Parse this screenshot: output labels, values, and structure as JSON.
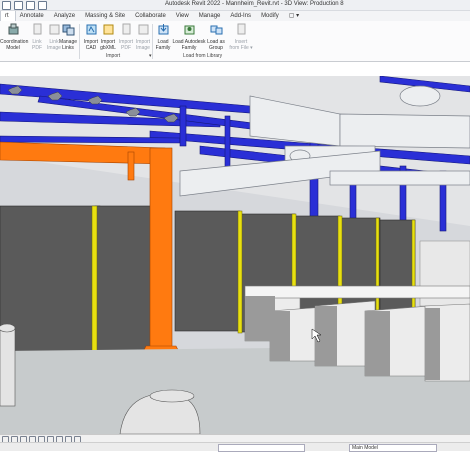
{
  "title": "Autodesk Revit 2022 - Mannheim_Revit.rvt - 3D View: Production 8",
  "tabs": [
    "rt",
    "Annotate",
    "Analyze",
    "Massing & Site",
    "Collaborate",
    "View",
    "Manage",
    "Add-Ins",
    "Modify",
    "▢ ▾"
  ],
  "ribbon": {
    "buttons": [
      {
        "label": "Coordination\nModel",
        "icon": "coordination-model-icon",
        "dim": false
      },
      {
        "label": "Link\nPDF",
        "icon": "link-pdf-icon",
        "dim": true
      },
      {
        "label": "Link\nImage",
        "icon": "link-image-icon",
        "dim": true
      },
      {
        "label": "Manage\nLinks",
        "icon": "manage-links-icon",
        "dim": false
      },
      {
        "label": "Import\nCAD",
        "icon": "import-cad-icon",
        "dim": false
      },
      {
        "label": "Import\ngbXML",
        "icon": "import-gbxml-icon",
        "dim": false
      },
      {
        "label": "Import\nPDF",
        "icon": "import-pdf-icon",
        "dim": true
      },
      {
        "label": "Import\nImage",
        "icon": "import-image-icon",
        "dim": true
      },
      {
        "label": "Load\nFamily",
        "icon": "load-family-icon",
        "dim": false
      },
      {
        "label": "Load Autodesk\nFamily",
        "icon": "load-autodesk-family-icon",
        "dim": false
      },
      {
        "label": "Load as\nGroup",
        "icon": "load-as-group-icon",
        "dim": false
      },
      {
        "label": "Insert\nfrom File ▾",
        "icon": "insert-from-file-icon",
        "dim": true
      }
    ],
    "panels": {
      "import": "Import",
      "load_from_library": "Load from Library"
    }
  },
  "status": {
    "model": "Main Model"
  },
  "colors": {
    "steel_blue": "#2a2fd6",
    "orange_column": "#ff7a10",
    "yellow_post": "#e8e011",
    "fence_gray": "#5a5a5a"
  }
}
